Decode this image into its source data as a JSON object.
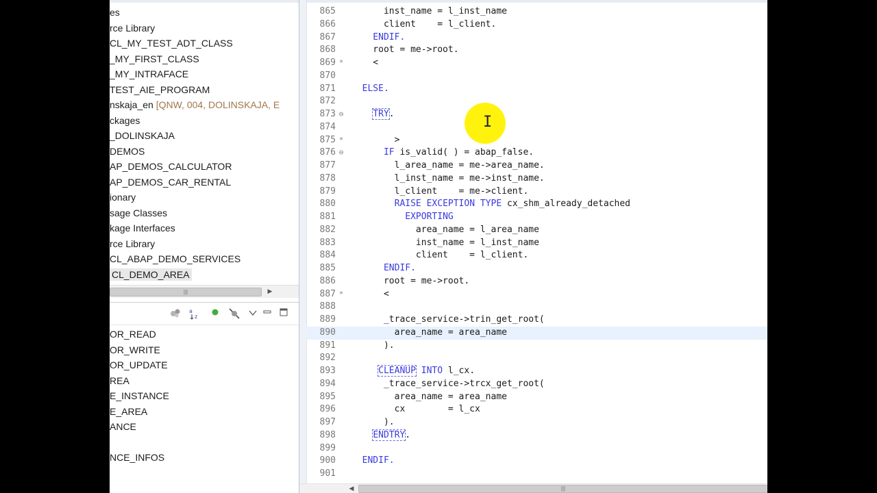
{
  "project_tree": {
    "items": [
      {
        "text": "es",
        "dim": ""
      },
      {
        "text": "rce Library",
        "dim": ""
      },
      {
        "text": "CL_MY_TEST_ADT_CLASS",
        "dim": ""
      },
      {
        "text": "_MY_FIRST_CLASS",
        "dim": ""
      },
      {
        "text": "_MY_INTRAFACE",
        "dim": ""
      },
      {
        "text": "TEST_AIE_PROGRAM",
        "dim": ""
      },
      {
        "text": "nskaja_en ",
        "dim": "[QNW, 004, DOLINSKAJA, E"
      },
      {
        "text": "ckages",
        "dim": ""
      },
      {
        "text": "_DOLINSKAJA",
        "dim": ""
      },
      {
        "text": "DEMOS",
        "dim": ""
      },
      {
        "text": "AP_DEMOS_CALCULATOR",
        "dim": ""
      },
      {
        "text": "AP_DEMOS_CAR_RENTAL",
        "dim": ""
      },
      {
        "text": "ionary",
        "dim": ""
      },
      {
        "text": "sage Classes",
        "dim": ""
      },
      {
        "text": "kage Interfaces",
        "dim": ""
      },
      {
        "text": "rce Library",
        "dim": ""
      },
      {
        "text": "CL_ABAP_DEMO_SERVICES",
        "dim": ""
      },
      {
        "text": "CL_DEMO_AREA",
        "dim": "",
        "selected": true
      }
    ],
    "hscroll_grip": "|||"
  },
  "outline": {
    "items": [
      "OR_READ",
      "OR_WRITE",
      "OR_UPDATE",
      "REA",
      "E_INSTANCE",
      "E_AREA",
      "ANCE",
      "",
      "NCE_INFOS"
    ],
    "scroll_grip": "≡"
  },
  "editor": {
    "lines": [
      {
        "n": "865",
        "m": "",
        "t": [
          [
            "",
            "      inst_name = l_inst_name"
          ]
        ]
      },
      {
        "n": "866",
        "m": "",
        "t": [
          [
            "",
            "      client    = l_client."
          ]
        ]
      },
      {
        "n": "867",
        "m": "",
        "t": [
          [
            "kw",
            "    ENDIF."
          ]
        ]
      },
      {
        "n": "868",
        "m": "",
        "t": [
          [
            "",
            "    root = me->root."
          ]
        ]
      },
      {
        "n": "869",
        "m": "*",
        "t": [
          [
            "",
            "    <"
          ]
        ]
      },
      {
        "n": "870",
        "m": "",
        "t": [
          [
            "",
            ""
          ]
        ]
      },
      {
        "n": "871",
        "m": "",
        "t": [
          [
            "kw",
            "  ELSE."
          ]
        ]
      },
      {
        "n": "872",
        "m": "",
        "t": [
          [
            "",
            ""
          ]
        ]
      },
      {
        "n": "873",
        "m": "⊖",
        "t": [
          [
            "",
            "    "
          ],
          [
            "kw boxed",
            "TRY"
          ],
          [
            "",
            "."
          ]
        ]
      },
      {
        "n": "874",
        "m": "",
        "t": [
          [
            "",
            ""
          ]
        ]
      },
      {
        "n": "875",
        "m": "*",
        "t": [
          [
            "",
            "        >"
          ]
        ]
      },
      {
        "n": "876",
        "m": "⊖",
        "t": [
          [
            "",
            "      "
          ],
          [
            "kw",
            "IF"
          ],
          [
            "",
            " is_valid( ) = abap_false."
          ]
        ]
      },
      {
        "n": "877",
        "m": "",
        "t": [
          [
            "",
            "        l_area_name = me->area_name."
          ]
        ]
      },
      {
        "n": "878",
        "m": "",
        "t": [
          [
            "",
            "        l_inst_name = me->inst_name."
          ]
        ]
      },
      {
        "n": "879",
        "m": "",
        "t": [
          [
            "",
            "        l_client    = me->client."
          ]
        ]
      },
      {
        "n": "880",
        "m": "",
        "t": [
          [
            "",
            "        "
          ],
          [
            "kw",
            "RAISE EXCEPTION TYPE"
          ],
          [
            "",
            " cx_shm_already_detached"
          ]
        ]
      },
      {
        "n": "881",
        "m": "",
        "t": [
          [
            "",
            "          "
          ],
          [
            "kw",
            "EXPORTING"
          ]
        ]
      },
      {
        "n": "882",
        "m": "",
        "t": [
          [
            "",
            "            area_name = l_area_name"
          ]
        ]
      },
      {
        "n": "883",
        "m": "",
        "t": [
          [
            "",
            "            inst_name = l_inst_name"
          ]
        ]
      },
      {
        "n": "884",
        "m": "",
        "t": [
          [
            "",
            "            client    = l_client."
          ]
        ]
      },
      {
        "n": "885",
        "m": "",
        "t": [
          [
            "",
            "      "
          ],
          [
            "kw",
            "ENDIF."
          ]
        ]
      },
      {
        "n": "886",
        "m": "",
        "t": [
          [
            "",
            "      root = me->root."
          ]
        ]
      },
      {
        "n": "887",
        "m": "*",
        "t": [
          [
            "",
            "      <"
          ]
        ]
      },
      {
        "n": "888",
        "m": "",
        "t": [
          [
            "",
            ""
          ]
        ]
      },
      {
        "n": "889",
        "m": "",
        "t": [
          [
            "",
            "      _trace_service->trin_get_root("
          ]
        ]
      },
      {
        "n": "890",
        "m": "",
        "t": [
          [
            "",
            "        area_name = area_name"
          ]
        ],
        "current": true
      },
      {
        "n": "891",
        "m": "",
        "t": [
          [
            "",
            "      )."
          ]
        ]
      },
      {
        "n": "892",
        "m": "",
        "t": [
          [
            "",
            ""
          ]
        ]
      },
      {
        "n": "893",
        "m": "",
        "t": [
          [
            "",
            "     "
          ],
          [
            "kw boxed",
            "CLEANUP"
          ],
          [
            "",
            " "
          ],
          [
            "kw",
            "INTO"
          ],
          [
            "",
            " l_cx."
          ]
        ]
      },
      {
        "n": "894",
        "m": "",
        "t": [
          [
            "",
            "      _trace_service->trcx_get_root("
          ]
        ]
      },
      {
        "n": "895",
        "m": "",
        "t": [
          [
            "",
            "        area_name = area_name"
          ]
        ]
      },
      {
        "n": "896",
        "m": "",
        "t": [
          [
            "",
            "        cx        = l_cx"
          ]
        ]
      },
      {
        "n": "897",
        "m": "",
        "t": [
          [
            "",
            "      )."
          ]
        ]
      },
      {
        "n": "898",
        "m": "",
        "t": [
          [
            "",
            "    "
          ],
          [
            "kw boxed",
            "ENDTRY"
          ],
          [
            "",
            "."
          ]
        ]
      },
      {
        "n": "899",
        "m": "",
        "t": [
          [
            "",
            ""
          ]
        ]
      },
      {
        "n": "900",
        "m": "",
        "t": [
          [
            "kw",
            "  ENDIF."
          ]
        ]
      },
      {
        "n": "901",
        "m": "",
        "t": [
          [
            "",
            ""
          ]
        ]
      }
    ],
    "hscroll_grip": "|||"
  },
  "icons": {
    "outline_toolbar": [
      "sort-members-icon",
      "sort-az-icon",
      "public-filter-icon",
      "hide-fields-icon",
      "view-menu-icon",
      "minimize-icon",
      "maximize-icon"
    ]
  },
  "colors": {
    "keyword": "#3a3adf",
    "current_line": "#e8f2fe",
    "cursor_highlight": "#fff200"
  }
}
